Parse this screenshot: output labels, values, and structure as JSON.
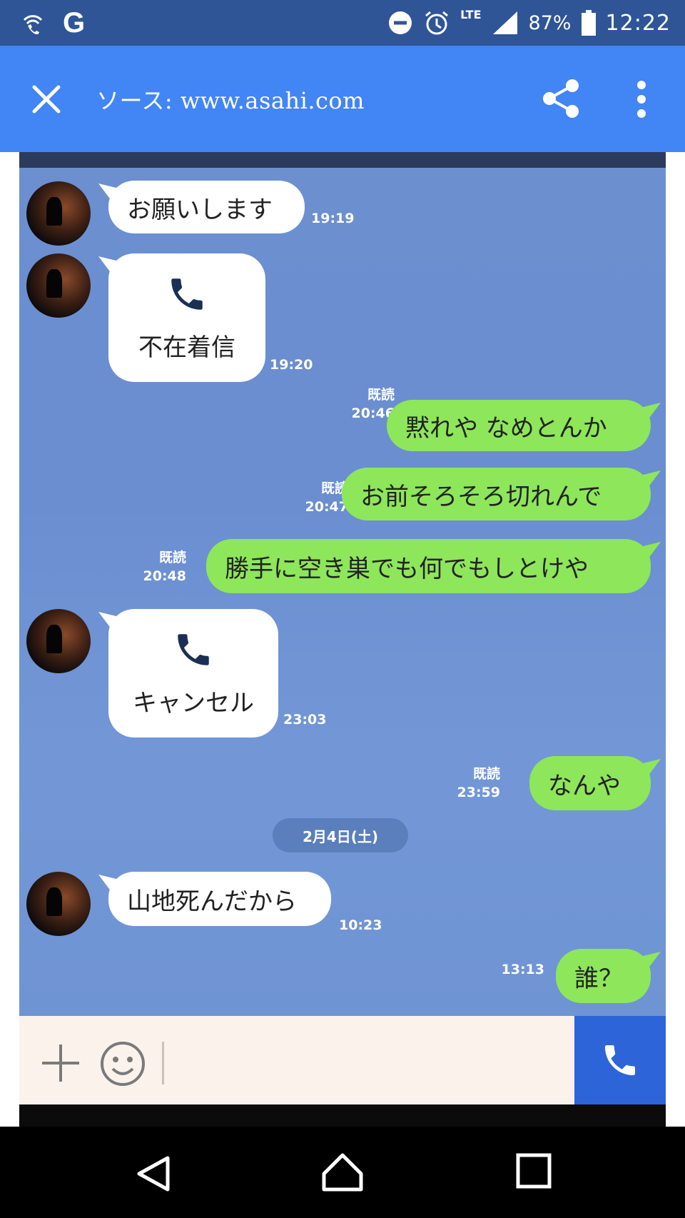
{
  "status_bar": {
    "left_icons": [
      "wifi-call-icon",
      "google-icon"
    ],
    "google_letter": "G",
    "network_type": "LTE",
    "battery_percent": "87%",
    "time": "12:22"
  },
  "app_bar": {
    "title": "ソース: www.asahi.com",
    "background_color": "#4285f4"
  },
  "chat": {
    "messages": [
      {
        "side": "left",
        "type": "text",
        "text": "お願いします",
        "time": "19:19"
      },
      {
        "side": "left",
        "type": "call",
        "text": "不在着信",
        "time": "19:20"
      },
      {
        "side": "right",
        "type": "text",
        "text": "黙れや なめとんか",
        "read": "既読",
        "time": "20:46"
      },
      {
        "side": "right",
        "type": "text",
        "text": "お前そろそろ切れんで",
        "read": "既読",
        "time": "20:47"
      },
      {
        "side": "right",
        "type": "text",
        "text": "勝手に空き巣でも何でもしとけや",
        "read": "既読",
        "time": "20:48"
      },
      {
        "side": "left",
        "type": "call",
        "text": "キャンセル",
        "time": "23:03"
      },
      {
        "side": "right",
        "type": "text",
        "text": "なんや",
        "read": "既読",
        "time": "23:59"
      },
      {
        "side": "left",
        "type": "text",
        "text": "山地死んだから",
        "time": "10:23"
      },
      {
        "side": "right",
        "type": "text",
        "text": "誰？",
        "time": "13:13"
      }
    ],
    "date_separator": "2月4日(土)",
    "bubble_colors": {
      "incoming": "#ffffff",
      "outgoing": "#8ee65a"
    }
  },
  "input_bar": {
    "icons": [
      "plus-icon",
      "smile-icon",
      "phone-icon"
    ]
  },
  "nav_bar": {
    "icons": [
      "back-icon",
      "home-icon",
      "recents-icon"
    ]
  }
}
